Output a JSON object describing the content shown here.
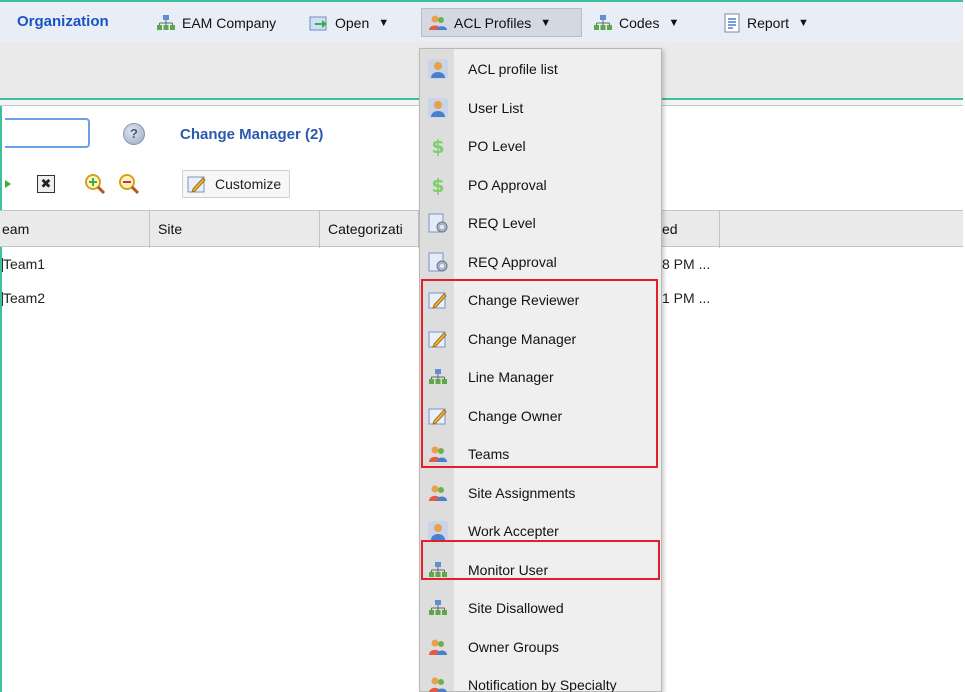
{
  "menubar": {
    "org_label": "Organization",
    "items": [
      {
        "label": "EAM Company",
        "caret": "",
        "icon": "org-chart-icon"
      },
      {
        "label": "Open",
        "caret": "▼",
        "icon": "open-arrow-icon"
      },
      {
        "label": "ACL Profiles",
        "caret": "▼",
        "icon": "users-icon"
      },
      {
        "label": "Codes",
        "caret": "▼",
        "icon": "org-chart-icon"
      },
      {
        "label": "Report",
        "caret": "▼",
        "icon": "report-icon"
      }
    ]
  },
  "panel": {
    "title": "Change Manager (2)",
    "help_glyph": "?",
    "close_glyph": "✖"
  },
  "toolbar": {
    "customize_label": "Customize"
  },
  "grid": {
    "columns": [
      "eam",
      "Site",
      "Categorizati",
      "ed"
    ],
    "rows": [
      {
        "team": "Team1",
        "time": "8 PM ..."
      },
      {
        "team": "Team2",
        "time": "1 PM ..."
      }
    ]
  },
  "dropdown": {
    "items": [
      {
        "label": "ACL profile list",
        "icon": "user-icon"
      },
      {
        "label": "User List",
        "icon": "user-icon"
      },
      {
        "label": "PO Level",
        "icon": "dollar-icon"
      },
      {
        "label": "PO Approval",
        "icon": "dollar-icon"
      },
      {
        "label": "REQ Level",
        "icon": "req-gear-icon"
      },
      {
        "label": "REQ Approval",
        "icon": "req-gear-icon"
      },
      {
        "label": "Change Reviewer",
        "icon": "pencil-note-icon"
      },
      {
        "label": "Change Manager",
        "icon": "pencil-note-icon"
      },
      {
        "label": "Line Manager",
        "icon": "org-chart-icon"
      },
      {
        "label": "Change Owner",
        "icon": "pencil-note-icon"
      },
      {
        "label": "Teams",
        "icon": "users-icon"
      },
      {
        "label": "Site Assignments",
        "icon": "users-icon"
      },
      {
        "label": "Work Accepter",
        "icon": "user-icon"
      },
      {
        "label": "Monitor User",
        "icon": "org-chart-icon"
      },
      {
        "label": "Site Disallowed",
        "icon": "org-chart-icon"
      },
      {
        "label": "Owner Groups",
        "icon": "users-icon"
      },
      {
        "label": "Notification by Specialty",
        "icon": "users-icon"
      }
    ]
  },
  "colors": {
    "highlight": "#e0202a",
    "org_link": "#1a54c4",
    "frame_accent": "#3cc0a0"
  }
}
